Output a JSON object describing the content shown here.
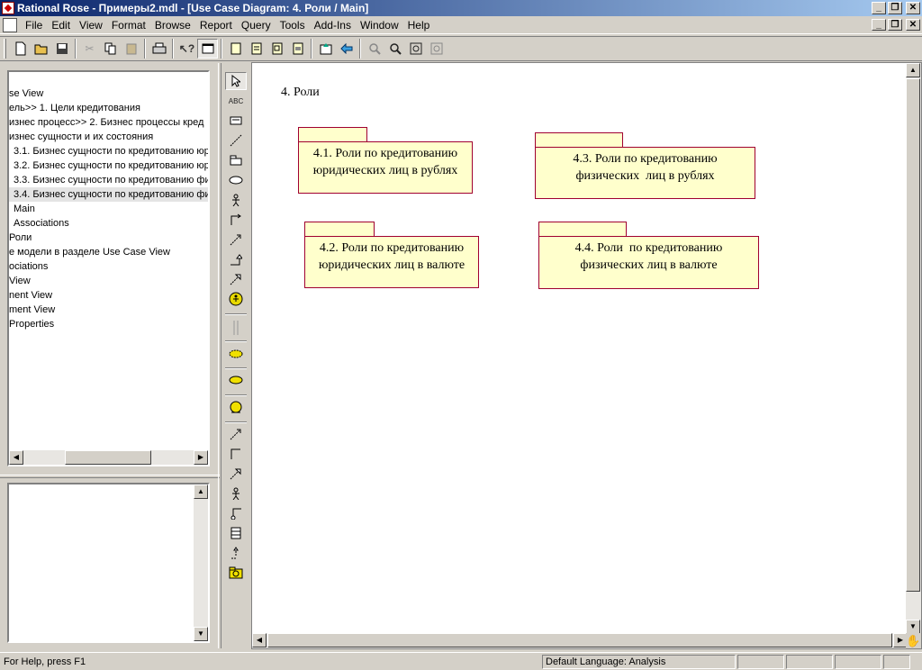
{
  "window": {
    "title": "Rational Rose - Примеры2.mdl - [Use Case Diagram: 4. Роли / Main]",
    "minimize": "_",
    "restore": "❐",
    "close": "✕"
  },
  "menu": [
    "File",
    "Edit",
    "View",
    "Format",
    "Browse",
    "Report",
    "Query",
    "Tools",
    "Add-Ins",
    "Window",
    "Help"
  ],
  "toolbar": {
    "icons": [
      "new-icon",
      "open-icon",
      "save-icon",
      "cut-icon",
      "copy-icon",
      "paste-icon",
      "print-icon",
      "context-help-icon",
      "view-docs-icon",
      "browse-class-diagram-icon",
      "browse-interaction-diagram-icon",
      "browse-component-diagram-icon",
      "browse-deployment-diagram-icon",
      "browse-parent-icon",
      "browse-previous-icon",
      "zoom-in-icon",
      "zoom-out-icon",
      "fit-window-icon",
      "undo-fit-icon"
    ]
  },
  "browser": {
    "nodes": [
      "se View",
      "ель>> 1. Цели кредитования",
      "изнес процесс>> 2. Бизнес процессы кред",
      "изнес сущности и их состояния",
      "3.1. Бизнес сущности по кредитованию юр",
      "3.2. Бизнес сущности по кредитованию юр",
      "3.3. Бизнес сущности по кредитованию фи",
      "3.4. Бизнес сущности по кредитованию фи",
      "Main",
      "Associations",
      "Роли",
      "е модели в разделе Use Case View",
      "ociations",
      "View",
      "nent View",
      "ment View",
      "Properties"
    ],
    "selected_index": 7,
    "documentation": ""
  },
  "toolbox": {
    "tools": [
      "selection-tool-icon",
      "text-box-icon",
      "note-icon",
      "anchor-note-icon",
      "package-icon",
      "use-case-icon",
      "actor-icon",
      "unidirectional-association-icon",
      "dependency-icon",
      "generalization-icon",
      "realize-icon",
      "business-actor-icon",
      "separator-icon",
      "business-use-case-icon",
      "use-case-realization-icon",
      "business-worker-icon",
      "association-icon",
      "flow-icon",
      "dependency2-icon",
      "actor2-icon",
      "generalization2-icon",
      "class-icon",
      "realize2-icon",
      "business-entity-icon"
    ]
  },
  "diagram": {
    "title": "4. Роли",
    "packages": [
      {
        "line1": "4.1. Роли по кредитованию",
        "line2": "юридических лиц в рублях"
      },
      {
        "line1": "4.3. Роли по кредитованию",
        "line2": "физических  лиц в рублях"
      },
      {
        "line1": "4.2. Роли по кредитованию",
        "line2": "юридических лиц в валюте"
      },
      {
        "line1": "4.4. Роли  по кредитованию",
        "line2": "физических лиц в валюте"
      }
    ]
  },
  "status": {
    "help": "For Help, press F1",
    "language": "Default Language: Analysis"
  }
}
